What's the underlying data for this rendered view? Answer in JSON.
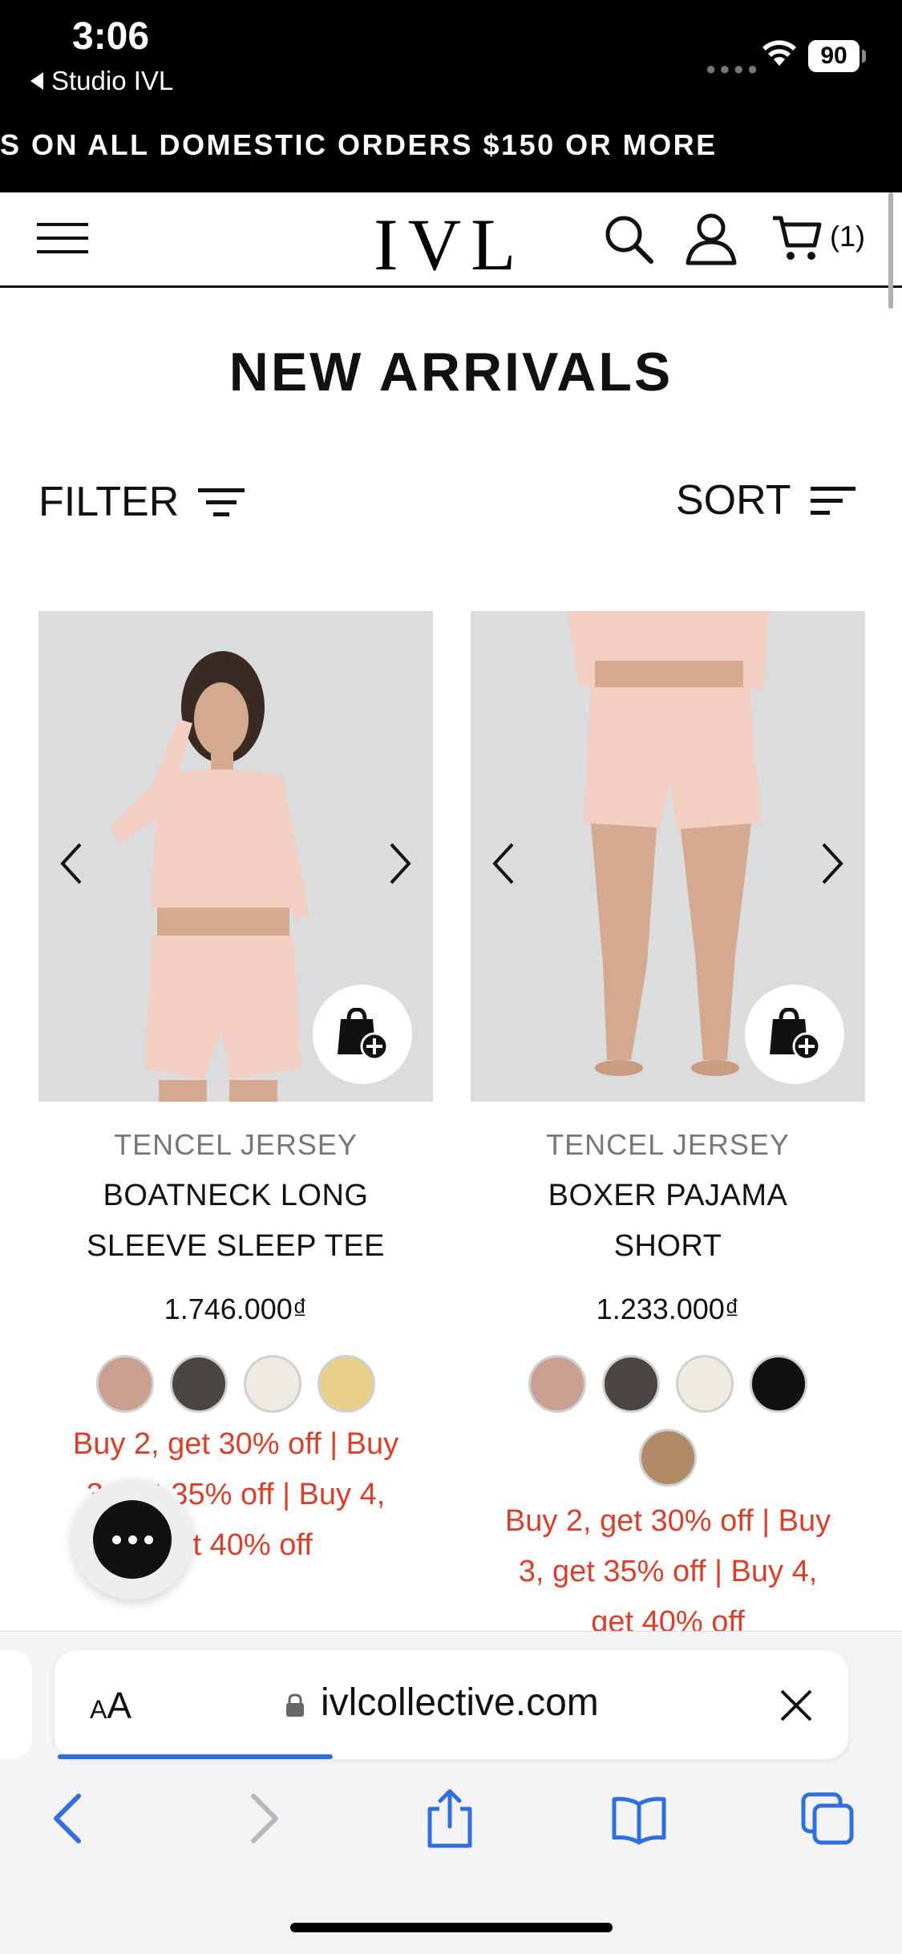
{
  "status_bar": {
    "time": "3:06",
    "back_app": "Studio IVL",
    "battery": "90"
  },
  "promo_banner": {
    "text": "S ON ALL DOMESTIC ORDERS $150 OR MORE"
  },
  "header": {
    "logo": "IVL",
    "cart_count": "(1)"
  },
  "page": {
    "title": "NEW ARRIVALS",
    "filter_label": "FILTER",
    "sort_label": "SORT"
  },
  "products": [
    {
      "category": "TENCEL JERSEY",
      "name_line1": "BOATNECK LONG",
      "name_line2": "SLEEVE SLEEP TEE",
      "price": "1.746.000₫",
      "swatches": [
        "#c9a08f",
        "#4a4644",
        "#eeebe3",
        "#e8cf8a"
      ],
      "offer_line1": "Buy 2, get 30% off | Buy",
      "offer_line2": "3, get 35% off | Buy 4,",
      "offer_line3": "get 40% off"
    },
    {
      "category": "TENCEL JERSEY",
      "name_line1": "BOXER PAJAMA",
      "name_line2": "SHORT",
      "price": "1.233.000₫",
      "swatches": [
        "#c9a08f",
        "#4a4644",
        "#eeebe3",
        "#111111",
        "#b08a66"
      ],
      "offer_line1": "Buy 2, get 30% off | Buy",
      "offer_line2": "3, get 35% off | Buy 4,",
      "offer_line3": "get 40% off"
    }
  ],
  "browser": {
    "aa_label": "AA",
    "url": "ivlcollective.com"
  },
  "colors": {
    "offer_red": "#d9402b",
    "safari_blue": "#2f6fe0"
  }
}
